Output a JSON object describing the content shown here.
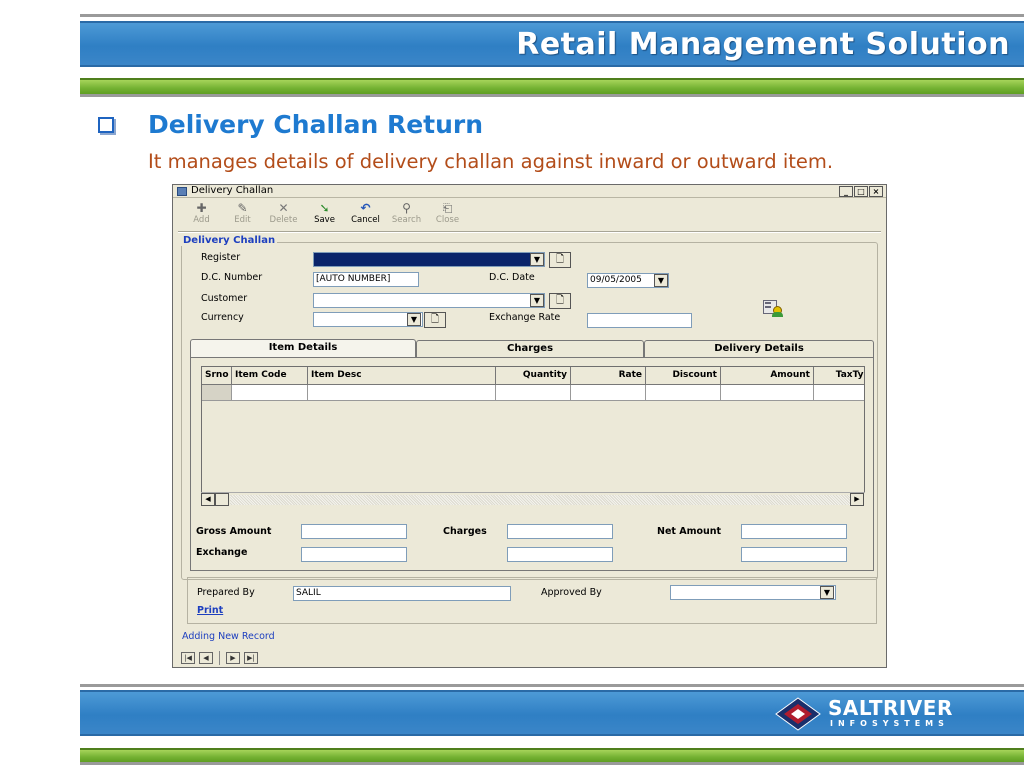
{
  "header": {
    "title": "Retail Management Solution"
  },
  "slide": {
    "heading": "Delivery Challan Return",
    "subtitle": "It manages details of delivery challan against inward or outward item."
  },
  "window": {
    "title": "Delivery Challan",
    "controls": {
      "minimize": "_",
      "maximize": "□",
      "close": "×"
    },
    "toolbar": [
      {
        "id": "add",
        "label": "Add",
        "enabled": false
      },
      {
        "id": "edit",
        "label": "Edit",
        "enabled": false
      },
      {
        "id": "delete",
        "label": "Delete",
        "enabled": false
      },
      {
        "id": "save",
        "label": "Save",
        "enabled": true
      },
      {
        "id": "cancel",
        "label": "Cancel",
        "enabled": true
      },
      {
        "id": "search",
        "label": "Search",
        "enabled": false
      },
      {
        "id": "close",
        "label": "Close",
        "enabled": false
      }
    ],
    "group_title": "Delivery Challan",
    "form": {
      "register_label": "Register",
      "register_value": "",
      "dc_number_label": "D.C. Number",
      "dc_number_value": "[AUTO NUMBER]",
      "dc_date_label": "D.C. Date",
      "dc_date_value": "09/05/2005",
      "customer_label": "Customer",
      "customer_value": "",
      "currency_label": "Currency",
      "currency_value": "",
      "exchange_rate_label": "Exchange Rate",
      "exchange_rate_value": ""
    },
    "tabs": [
      {
        "label": "Item Details",
        "active": true
      },
      {
        "label": "Charges",
        "active": false
      },
      {
        "label": "Delivery Details",
        "active": false
      }
    ],
    "grid": {
      "columns": [
        "Srno",
        "Item Code",
        "Item Desc",
        "Quantity",
        "Rate",
        "Discount",
        "Amount",
        "TaxTyp"
      ]
    },
    "totals": {
      "gross_amount_label": "Gross Amount",
      "charges_label": "Charges",
      "net_amount_label": "Net Amount",
      "exchange_label": "Exchange"
    },
    "footer": {
      "prepared_by_label": "Prepared By",
      "prepared_by_value": "SALIL",
      "approved_by_label": "Approved By",
      "approved_by_value": "",
      "print_label": "Print",
      "status": "Adding New Record"
    }
  },
  "logo": {
    "name": "SALTRIVER",
    "sub": "INFOSYSTEMS"
  },
  "colors": {
    "header_blue": "#2f7fc4",
    "accent_green": "#73b132",
    "heading_blue": "#1e7ad0",
    "subtitle_brown": "#b34d1a"
  }
}
